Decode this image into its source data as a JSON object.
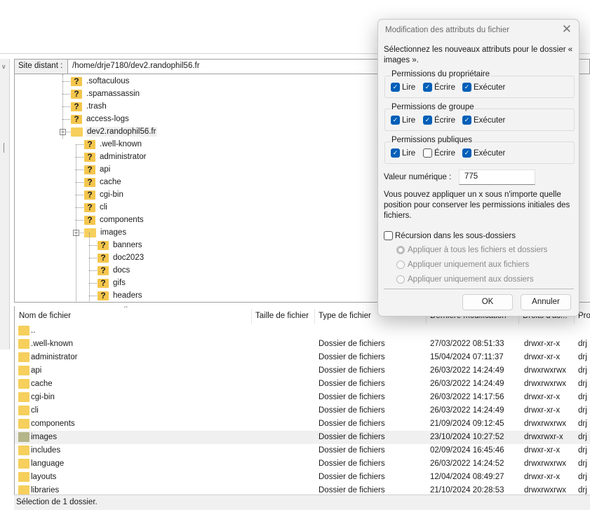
{
  "remote": {
    "site_label": "Site distant :",
    "path": "/home/drje7180/dev2.randophil56.fr"
  },
  "tree": [
    {
      "name": ".softaculous",
      "level": 1,
      "icon": "unknown-folder-icon"
    },
    {
      "name": ".spamassassin",
      "level": 1,
      "icon": "unknown-folder-icon"
    },
    {
      "name": ".trash",
      "level": 1,
      "icon": "unknown-folder-icon"
    },
    {
      "name": "access-logs",
      "level": 1,
      "icon": "unknown-folder-icon"
    },
    {
      "name": "dev2.randophil56.fr",
      "level": 1,
      "icon": "folder-icon",
      "expanded": true,
      "selected": true
    },
    {
      "name": ".well-known",
      "level": 2,
      "icon": "unknown-folder-icon"
    },
    {
      "name": "administrator",
      "level": 2,
      "icon": "unknown-folder-icon"
    },
    {
      "name": "api",
      "level": 2,
      "icon": "unknown-folder-icon"
    },
    {
      "name": "cache",
      "level": 2,
      "icon": "unknown-folder-icon"
    },
    {
      "name": "cgi-bin",
      "level": 2,
      "icon": "unknown-folder-icon"
    },
    {
      "name": "cli",
      "level": 2,
      "icon": "unknown-folder-icon"
    },
    {
      "name": "components",
      "level": 2,
      "icon": "unknown-folder-icon"
    },
    {
      "name": "images",
      "level": 2,
      "icon": "folder-icon",
      "expanded": true
    },
    {
      "name": "banners",
      "level": 3,
      "icon": "unknown-folder-icon"
    },
    {
      "name": "doc2023",
      "level": 3,
      "icon": "unknown-folder-icon"
    },
    {
      "name": "docs",
      "level": 3,
      "icon": "unknown-folder-icon"
    },
    {
      "name": "gifs",
      "level": 3,
      "icon": "unknown-folder-icon"
    },
    {
      "name": "headers",
      "level": 3,
      "icon": "unknown-folder-icon"
    }
  ],
  "list": {
    "columns": [
      "Nom de fichier",
      "Taille de fichier",
      "Type de fichier",
      "Dernière modification",
      "Droits d'ac...",
      "Pro"
    ],
    "rows": [
      {
        "name": "..",
        "type": "",
        "modified": "",
        "perms": "",
        "owner": ""
      },
      {
        "name": ".well-known",
        "type": "Dossier de fichiers",
        "modified": "27/03/2022 08:51:33",
        "perms": "drwxr-xr-x",
        "owner": "drj"
      },
      {
        "name": "administrator",
        "type": "Dossier de fichiers",
        "modified": "15/04/2024 07:11:37",
        "perms": "drwxr-xr-x",
        "owner": "drj"
      },
      {
        "name": "api",
        "type": "Dossier de fichiers",
        "modified": "26/03/2022 14:24:49",
        "perms": "drwxrwxrwx",
        "owner": "drj"
      },
      {
        "name": "cache",
        "type": "Dossier de fichiers",
        "modified": "26/03/2022 14:24:49",
        "perms": "drwxrwxrwx",
        "owner": "drj"
      },
      {
        "name": "cgi-bin",
        "type": "Dossier de fichiers",
        "modified": "26/03/2022 14:17:56",
        "perms": "drwxr-xr-x",
        "owner": "drj"
      },
      {
        "name": "cli",
        "type": "Dossier de fichiers",
        "modified": "26/03/2022 14:24:49",
        "perms": "drwxr-xr-x",
        "owner": "drj"
      },
      {
        "name": "components",
        "type": "Dossier de fichiers",
        "modified": "21/09/2024 09:12:45",
        "perms": "drwxrwxrwx",
        "owner": "drj"
      },
      {
        "name": "images",
        "type": "Dossier de fichiers",
        "modified": "23/10/2024 10:27:52",
        "perms": "drwxrwxr-x",
        "owner": "drj",
        "selected": true
      },
      {
        "name": "includes",
        "type": "Dossier de fichiers",
        "modified": "02/09/2024 16:45:46",
        "perms": "drwxr-xr-x",
        "owner": "drj"
      },
      {
        "name": "language",
        "type": "Dossier de fichiers",
        "modified": "26/03/2022 14:24:52",
        "perms": "drwxrwxrwx",
        "owner": "drj"
      },
      {
        "name": "layouts",
        "type": "Dossier de fichiers",
        "modified": "12/04/2024 08:49:27",
        "perms": "drwxr-xr-x",
        "owner": "drj"
      },
      {
        "name": "libraries",
        "type": "Dossier de fichiers",
        "modified": "21/10/2024 20:28:53",
        "perms": "drwxrwxrwx",
        "owner": "drj"
      }
    ]
  },
  "status": "Sélection de 1 dossier.",
  "dialog": {
    "title": "Modification des attributs du fichier",
    "intro": "Sélectionnez les nouveaux attributs pour le dossier « images ».",
    "groups": [
      {
        "label": "Permissions du propriétaire",
        "read": true,
        "write": true,
        "exec": true
      },
      {
        "label": "Permissions de groupe",
        "read": true,
        "write": true,
        "exec": true
      },
      {
        "label": "Permissions publiques",
        "read": true,
        "write": false,
        "exec": true
      }
    ],
    "perm_labels": {
      "read": "Lire",
      "write": "Écrire",
      "exec": "Exécuter"
    },
    "numeric_label": "Valeur numérique :",
    "numeric_value": "775",
    "hint": "Vous pouvez appliquer un x sous n'importe quelle position pour conserver les permissions initiales des fichiers.",
    "recursion_label": "Récursion dans les sous-dossiers",
    "recursion_checked": false,
    "radios": [
      {
        "label": "Appliquer à tous les fichiers et dossiers",
        "selected": true
      },
      {
        "label": "Appliquer uniquement aux fichiers",
        "selected": false
      },
      {
        "label": "Appliquer uniquement aux dossiers",
        "selected": false
      }
    ],
    "ok": "OK",
    "cancel": "Annuler"
  },
  "colors": {
    "accent": "#005fb8",
    "folder": "#f6cf5c",
    "selection": "#f0f0f0"
  }
}
